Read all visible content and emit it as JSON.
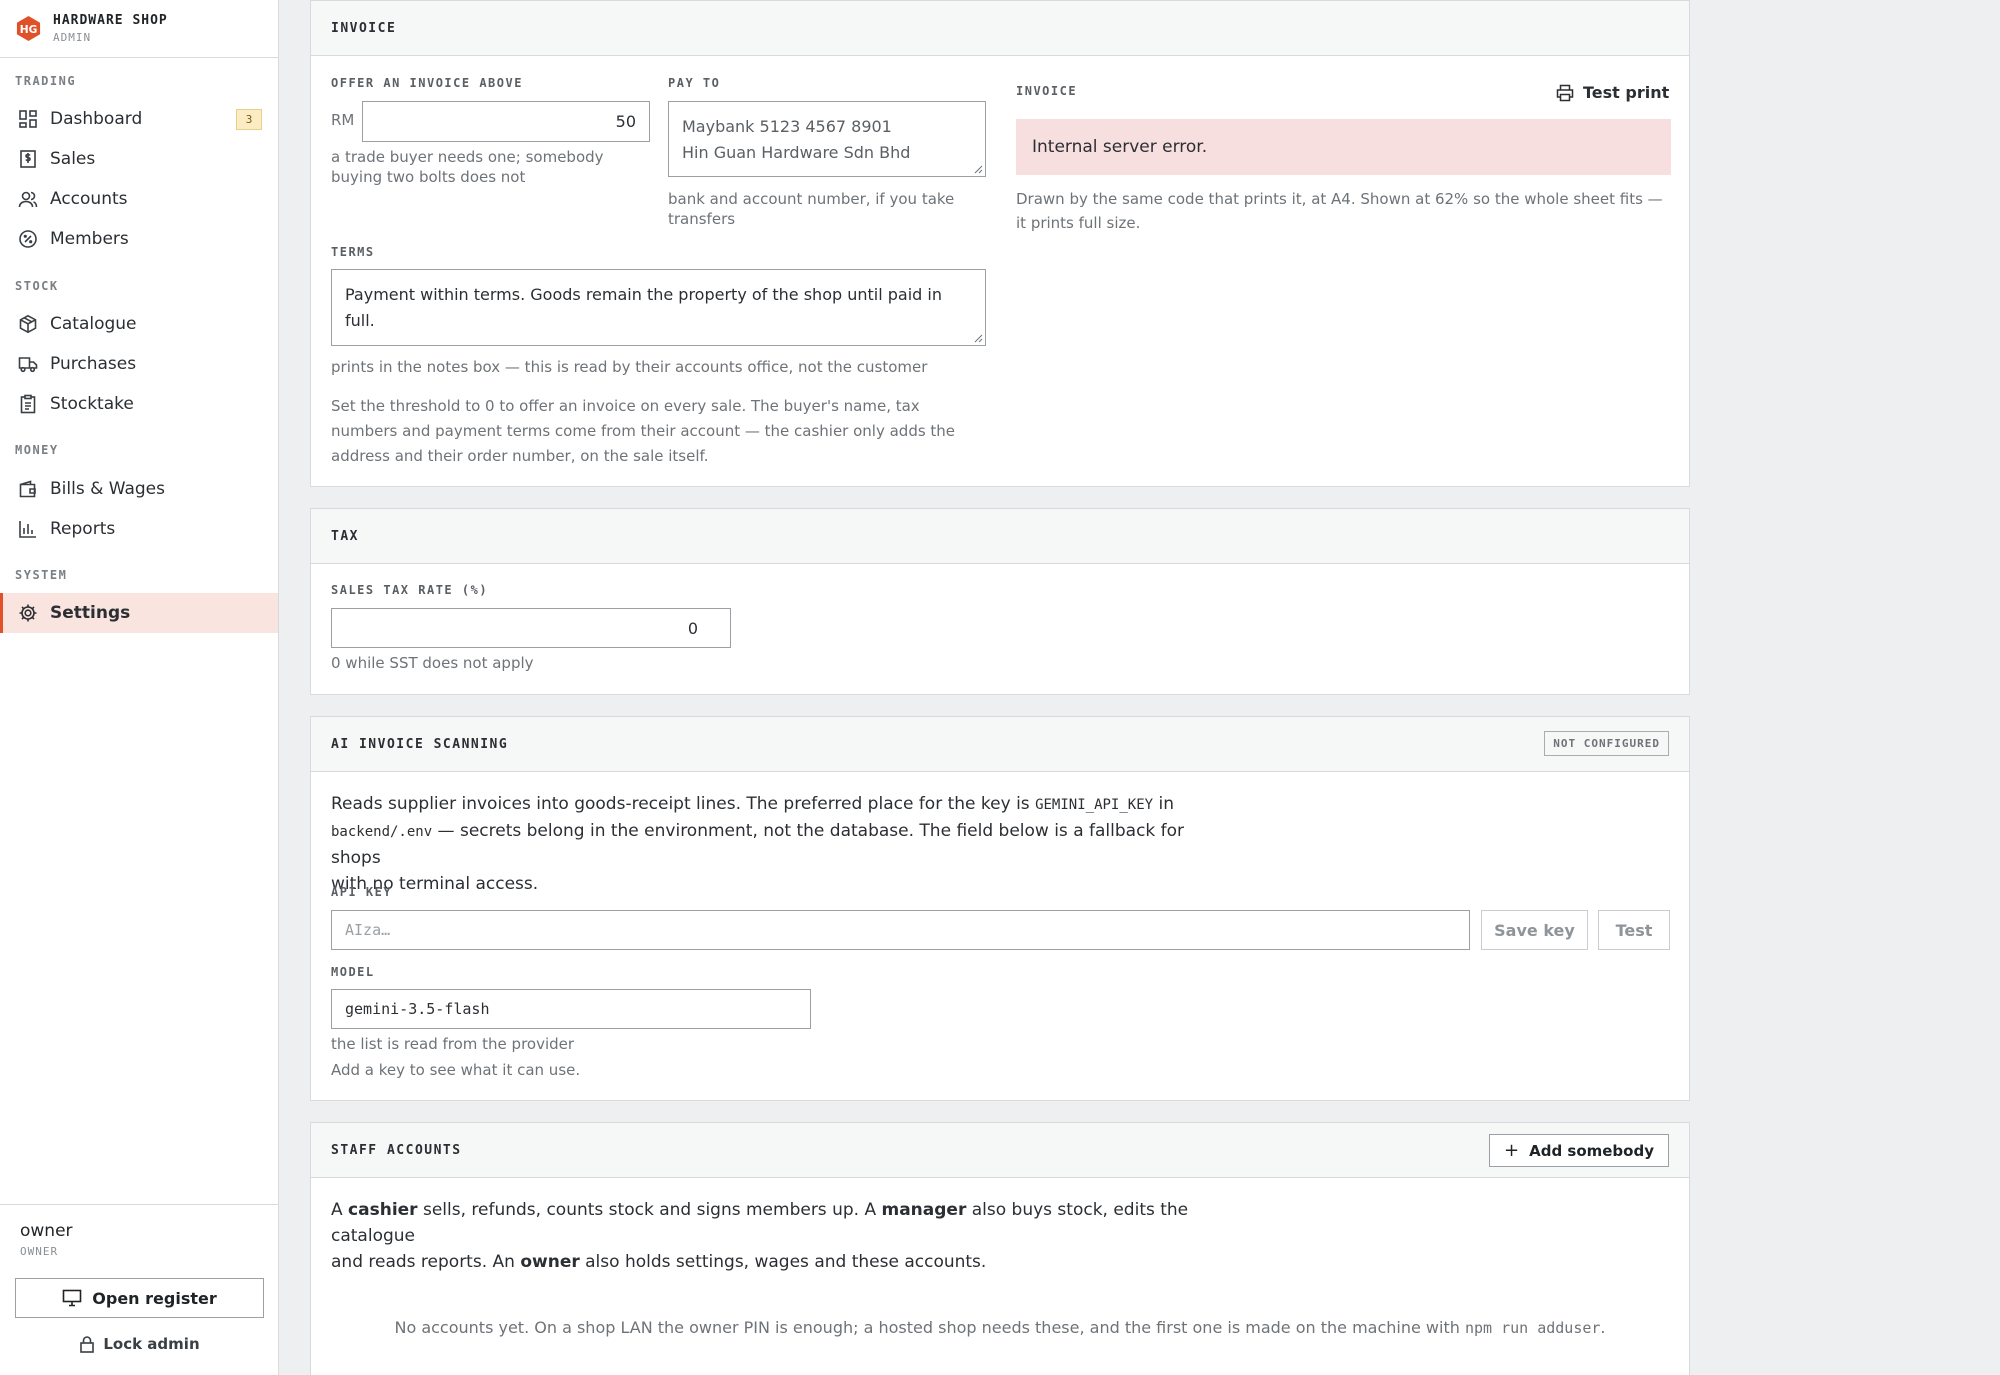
{
  "brand": {
    "logo_text": "HG",
    "title": "HARDWARE SHOP",
    "subtitle": "ADMIN"
  },
  "nav": {
    "sections": [
      {
        "label": "TRADING",
        "items": [
          {
            "label": "Dashboard",
            "icon": "dashboard-icon",
            "badge": "3"
          },
          {
            "label": "Sales",
            "icon": "receipt-dollar-icon"
          },
          {
            "label": "Accounts",
            "icon": "users-icon"
          },
          {
            "label": "Members",
            "icon": "badge-percent-icon"
          }
        ]
      },
      {
        "label": "STOCK",
        "items": [
          {
            "label": "Catalogue",
            "icon": "box-icon"
          },
          {
            "label": "Purchases",
            "icon": "truck-icon"
          },
          {
            "label": "Stocktake",
            "icon": "clipboard-icon"
          }
        ]
      },
      {
        "label": "MONEY",
        "items": [
          {
            "label": "Bills & Wages",
            "icon": "wallet-icon"
          },
          {
            "label": "Reports",
            "icon": "bar-chart-icon"
          }
        ]
      },
      {
        "label": "SYSTEM",
        "items": [
          {
            "label": "Settings",
            "icon": "gear-icon",
            "active": true
          }
        ]
      }
    ]
  },
  "user": {
    "name": "owner",
    "role": "OWNER",
    "open_register": "Open register",
    "lock_admin": "Lock admin"
  },
  "invoice": {
    "title": "INVOICE",
    "threshold_label": "OFFER AN INVOICE ABOVE",
    "currency": "RM",
    "threshold_value": "50",
    "threshold_hint": "a trade buyer needs one; somebody buying two bolts does not",
    "pay_to_label": "PAY TO",
    "pay_to_line1": "Maybank 5123 4567 8901",
    "pay_to_line2": "Hin Guan Hardware Sdn Bhd",
    "pay_to_hint": "bank and account number, if you take transfers",
    "terms_label": "TERMS",
    "terms_value": "Payment within terms. Goods remain the property of the shop until paid in full.",
    "terms_hint": "prints in the notes box — this is read by their accounts office, not the customer",
    "note": "Set the threshold to 0 to offer an invoice on every sale. The buyer's name, tax numbers and payment terms come from their account — the cashier only adds the address and their order number, on the sale itself.",
    "preview_label": "INVOICE",
    "test_print": "Test print",
    "error": "Internal server error.",
    "preview_hint": "Drawn by the same code that prints it, at A4. Shown at 62% so the whole sheet fits — it prints full size."
  },
  "tax": {
    "title": "TAX",
    "rate_label": "SALES TAX RATE (%)",
    "rate_value": "0",
    "rate_hint": "0 while SST does not apply"
  },
  "ai": {
    "title": "AI INVOICE SCANNING",
    "status": "NOT CONFIGURED",
    "desc_1": "Reads supplier invoices into goods-receipt lines. The preferred place for the key is ",
    "desc_code1": "GEMINI_API_KEY",
    "desc_2": " in",
    "desc_code2": "backend/.env",
    "desc_3": " — secrets belong in the environment, not the database. The field below is a fallback for shops",
    "desc_4": "with no terminal access.",
    "key_label": "API KEY",
    "key_placeholder": "AIza…",
    "save_key": "Save key",
    "test": "Test",
    "model_label": "MODEL",
    "model_value": "gemini-3.5-flash",
    "model_hint_1": "the list is read from the provider",
    "model_hint_2": "Add a key to see what it can use."
  },
  "staff": {
    "title": "STAFF ACCOUNTS",
    "add_button": "Add somebody",
    "desc_a": "A ",
    "role_cashier": "cashier",
    "desc_b": " sells, refunds, counts stock and signs members up. A ",
    "role_manager": "manager",
    "desc_c": " also buys stock, edits the catalogue",
    "desc_d": "and reads reports. An ",
    "role_owner": "owner",
    "desc_e": " also holds settings, wages and these accounts.",
    "empty_text": "No accounts yet. On a shop LAN the owner PIN is enough; a hosted shop needs these, and the first one is made on the machine with ",
    "empty_code": "npm run adduser",
    "empty_end": "."
  },
  "colors": {
    "accent": "#e0512a",
    "active_bg": "#f9e4e0",
    "error_bg": "#f7dfe0",
    "badge_bg": "#fbecc4"
  }
}
